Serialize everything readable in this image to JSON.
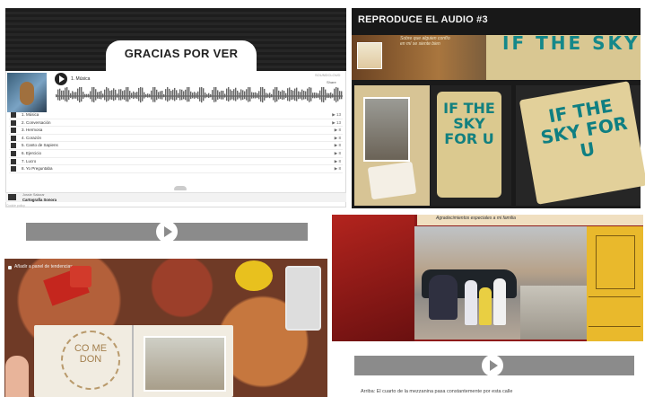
{
  "embed": {
    "heading": "GRACIAS POR VER",
    "artist": "",
    "track_title": "1. Música",
    "soundcloud_label": "SOUNDCLOUD",
    "share_label": "Share",
    "tracks": [
      {
        "name": "1. Música",
        "plays": "13"
      },
      {
        "name": "2. Conversación",
        "plays": "13"
      },
      {
        "name": "3. Hermosa",
        "plays": "8"
      },
      {
        "name": "4. Corazón",
        "plays": "8"
      },
      {
        "name": "5. Canto de Sapiens",
        "plays": "8"
      },
      {
        "name": "6. Ejercicio",
        "plays": "8"
      },
      {
        "name": "7. Lucro",
        "plays": "8"
      },
      {
        "name": "8. Yo Preguntaba",
        "plays": "8"
      }
    ],
    "footer_line1": "Jossie Salazar",
    "footer_line2": "Cartografía Sonora",
    "footer_line3": "Cookie policy"
  },
  "audio_panel": {
    "heading": "REPRODUCE EL AUDIO #3",
    "note_text": "Sobre que alguien confío en mí se siente bien",
    "book_text_top": "IF THE SKY",
    "book_text_mid": "IF THE SKY FOR U",
    "book_text_right": "IF THE SKY FOR U"
  },
  "scrapbook": {
    "add_label": "Añadir a panel de tendencias",
    "notebook_word": "CO ME DON"
  },
  "photo_panel": {
    "handwriting": "Agradecimientos especiales a mi familia"
  },
  "caption": "Arriba: El cuarto de la mezzanina pasa constantemente por esta calle",
  "colors": {
    "video_bar": "#8b8b8b",
    "book_teal": "#14888a",
    "banner_dark": "#1d1d1d"
  }
}
